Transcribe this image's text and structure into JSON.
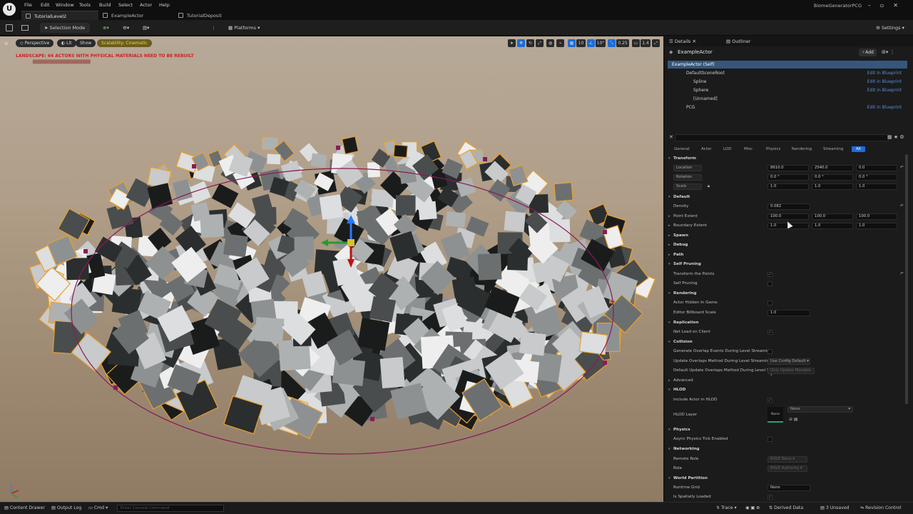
{
  "titlebar": {
    "menus": [
      "File",
      "Edit",
      "Window",
      "Tools",
      "Build",
      "Select",
      "Actor",
      "Help"
    ],
    "tabs": [
      "TutorialLevel2",
      "ExampleActor",
      "TutorialDeposit"
    ],
    "app_name": "BiomeGeneratorPCG"
  },
  "toolbar": {
    "mode": "Selection Mode",
    "platforms": "Platforms",
    "settings": "Settings"
  },
  "viewport": {
    "perspective": "Perspective",
    "lit": "Lit",
    "show": "Show",
    "scalability": "Scalability: Cinematic",
    "warning": "LANDSCAPE: 64 ACTORS WITH PHYSICAL MATERIALS NEED TO BE REBUILT",
    "snap_value": "10",
    "angle_value": "10°",
    "scale_value": "0.25",
    "cam_speed": "1.4"
  },
  "bottombar": {
    "content_drawer": "Content Drawer",
    "output_log": "Output Log",
    "cmd": "Cmd",
    "console_placeholder": "Enter Console Command",
    "trace": "Trace",
    "derived_data": "Derived Data",
    "unsaved": "3 Unsaved",
    "revision": "Revision Control"
  },
  "panel": {
    "tabs": [
      "Details",
      "Outliner"
    ],
    "actor_name": "ExampleActor",
    "add_label": "Add",
    "tree": [
      {
        "label": "ExampleActor (Self)",
        "edit": ""
      },
      {
        "label": "DefaultSceneRoot",
        "edit": "Edit in Blueprint"
      },
      {
        "label": "Spline",
        "edit": "Edit in Blueprint"
      },
      {
        "label": "Sphere",
        "edit": "Edit in Blueprint"
      },
      {
        "label": "[Unnamed]",
        "edit": ""
      },
      {
        "label": "PCG",
        "edit": "Edit in Blueprint"
      }
    ],
    "filter_tabs": [
      "General",
      "Actor",
      "LOD",
      "Misc",
      "Physics",
      "Rendering",
      "Streaming",
      "All"
    ],
    "transform": {
      "section": "Transform",
      "location": "Location",
      "rotation": "Rotation",
      "scale": "Scale",
      "loc": [
        "8610.0",
        "2540.0",
        "0.0"
      ],
      "rot": [
        "0.0 °",
        "0.0 °",
        "0.0 °"
      ],
      "scl": [
        "1.0",
        "1.0",
        "1.0"
      ]
    },
    "default": {
      "section": "Default",
      "density": "Density",
      "density_val": "0.082",
      "point_extent": "Point Extent",
      "pe": [
        "100.0",
        "100.0",
        "100.0"
      ],
      "boundary_extent": "Boundary Extent",
      "be": [
        "1.0",
        "1.0",
        "1.0"
      ],
      "spawn": "Spawn",
      "debug": "Debug",
      "path": "Path"
    },
    "self_pruning": {
      "section": "Self Pruning",
      "transform": "Transform the Points",
      "pruning": "Self Pruning"
    },
    "rendering": {
      "section": "Rendering",
      "hidden": "Actor Hidden In Game",
      "billboard": "Editor Billboard Scale",
      "billboard_val": "1.0"
    },
    "replication": {
      "section": "Replication",
      "net_load": "Net Load on Client"
    },
    "collision": {
      "section": "Collision",
      "gen_overlap": "Generate Overlap Events During Level Streaming",
      "update_overlaps": "Update Overlaps Method During Level Streaming",
      "update_val": "Use Config Default",
      "default_update": "Default Update Overlaps Method During Level S...",
      "default_val": "Only Update Movable"
    },
    "advanced": "Advanced",
    "hlod": {
      "section": "HLOD",
      "include": "Include Actor in HLOD",
      "layer": "HLOD Layer",
      "layer_thumb": "None",
      "layer_val": "None"
    },
    "physics": {
      "section": "Physics",
      "async": "Async Physics Tick Enabled"
    },
    "networking": {
      "section": "Networking",
      "remote_role": "Remote Role",
      "remote_val": "ROLE None",
      "role": "Role",
      "role_val": "ROLE Authority"
    },
    "world_partition": {
      "section": "World Partition",
      "grid": "Runtime Grid",
      "grid_val": "None",
      "spatial": "Is Spatially Loaded"
    }
  }
}
